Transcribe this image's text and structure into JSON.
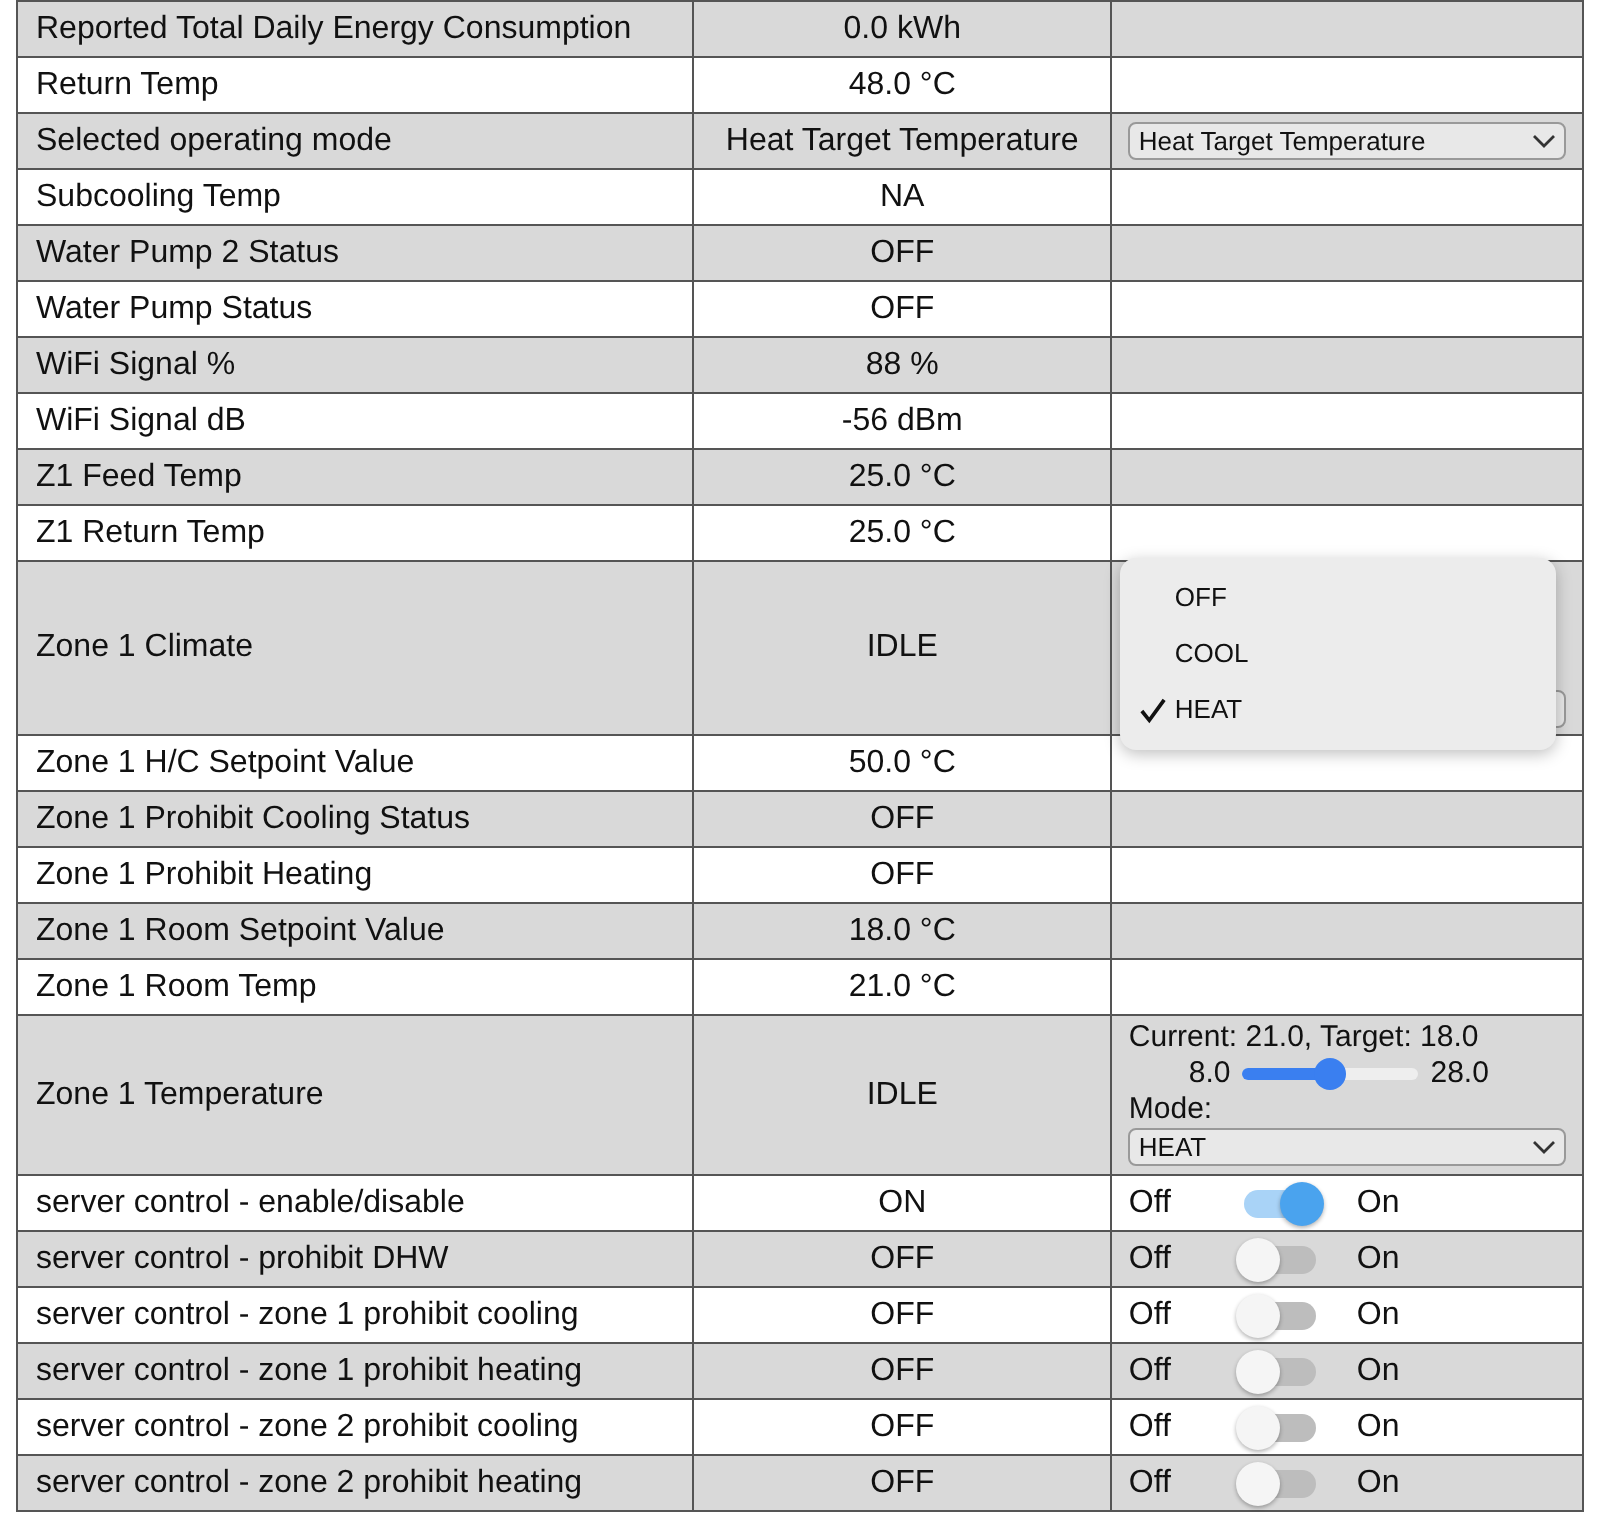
{
  "rows": [
    {
      "kind": "plain",
      "name": "Reported Total Daily Energy Consumption",
      "value": "0.0 kWh"
    },
    {
      "kind": "plain",
      "name": "Return Temp",
      "value": "48.0 °C"
    },
    {
      "kind": "select",
      "name": "Selected operating mode",
      "value": "Heat Target Temperature",
      "control": {
        "value": "Heat Target Temperature"
      }
    },
    {
      "kind": "plain",
      "name": "Subcooling Temp",
      "value": "NA"
    },
    {
      "kind": "plain",
      "name": "Water Pump 2 Status",
      "value": "OFF"
    },
    {
      "kind": "plain",
      "name": "Water Pump Status",
      "value": "OFF"
    },
    {
      "kind": "plain",
      "name": "WiFi Signal %",
      "value": "88 %"
    },
    {
      "kind": "plain",
      "name": "WiFi Signal dB",
      "value": "-56 dBm"
    },
    {
      "kind": "plain",
      "name": "Z1 Feed Temp",
      "value": "25.0 °C"
    },
    {
      "kind": "plain",
      "name": "Z1 Return Temp",
      "value": "25.0 °C"
    },
    {
      "kind": "climate",
      "name": "Zone 1 Climate",
      "value": "IDLE",
      "menu": [
        {
          "label": "OFF",
          "selected": false
        },
        {
          "label": "COOL",
          "selected": false
        },
        {
          "label": "HEAT",
          "selected": true
        }
      ]
    },
    {
      "kind": "plain",
      "name": "Zone 1 H/C Setpoint Value",
      "value": "50.0 °C"
    },
    {
      "kind": "plain",
      "name": "Zone 1 Prohibit Cooling Status",
      "value": "OFF"
    },
    {
      "kind": "plain",
      "name": "Zone 1 Prohibit Heating",
      "value": "OFF"
    },
    {
      "kind": "plain",
      "name": "Zone 1 Room Setpoint Value",
      "value": "18.0 °C"
    },
    {
      "kind": "plain",
      "name": "Zone 1 Room Temp",
      "value": "21.0 °C"
    },
    {
      "kind": "thermostat",
      "name": "Zone 1 Temperature",
      "value": "IDLE",
      "status": "Current: 21.0, Target: 18.0",
      "min": "8.0",
      "max": "28.0",
      "level": 0.5,
      "mode_label": "Mode:",
      "mode": "HEAT"
    },
    {
      "kind": "switch",
      "name": "server control - enable/disable",
      "value": "ON",
      "off_label": "Off",
      "on_label": "On",
      "on": true
    },
    {
      "kind": "switch",
      "name": "server control - prohibit DHW",
      "value": "OFF",
      "off_label": "Off",
      "on_label": "On",
      "on": false
    },
    {
      "kind": "switch",
      "name": "server control - zone 1 prohibit cooling",
      "value": "OFF",
      "off_label": "Off",
      "on_label": "On",
      "on": false
    },
    {
      "kind": "switch",
      "name": "server control - zone 1 prohibit heating",
      "value": "OFF",
      "off_label": "Off",
      "on_label": "On",
      "on": false
    },
    {
      "kind": "switch",
      "name": "server control - zone 2 prohibit cooling",
      "value": "OFF",
      "off_label": "Off",
      "on_label": "On",
      "on": false
    },
    {
      "kind": "switch",
      "name": "server control - zone 2 prohibit heating",
      "value": "OFF",
      "off_label": "Off",
      "on_label": "On",
      "on": false
    }
  ]
}
